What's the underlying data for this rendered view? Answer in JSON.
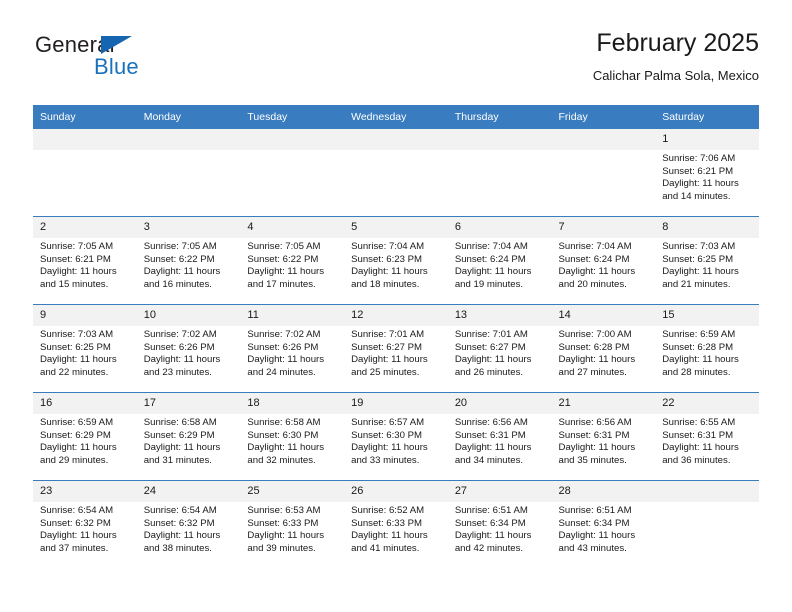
{
  "brand": {
    "line1": "General",
    "line2": "Blue",
    "triangle_color": "#1565b0",
    "blue_color": "#1972bb"
  },
  "header": {
    "title": "February 2025",
    "subtitle": "Calichar Palma Sola, Mexico"
  },
  "theme": {
    "header_bg": "#3a7cc0",
    "daynum_bg": "#f2f2f2",
    "row_border": "#3a7cc0"
  },
  "weekday_headers": [
    "Sunday",
    "Monday",
    "Tuesday",
    "Wednesday",
    "Thursday",
    "Friday",
    "Saturday"
  ],
  "weeks": [
    [
      {
        "day": "",
        "sunrise": "",
        "sunset": "",
        "daylight1": "",
        "daylight2": ""
      },
      {
        "day": "",
        "sunrise": "",
        "sunset": "",
        "daylight1": "",
        "daylight2": ""
      },
      {
        "day": "",
        "sunrise": "",
        "sunset": "",
        "daylight1": "",
        "daylight2": ""
      },
      {
        "day": "",
        "sunrise": "",
        "sunset": "",
        "daylight1": "",
        "daylight2": ""
      },
      {
        "day": "",
        "sunrise": "",
        "sunset": "",
        "daylight1": "",
        "daylight2": ""
      },
      {
        "day": "",
        "sunrise": "",
        "sunset": "",
        "daylight1": "",
        "daylight2": ""
      },
      {
        "day": "1",
        "sunrise": "Sunrise: 7:06 AM",
        "sunset": "Sunset: 6:21 PM",
        "daylight1": "Daylight: 11 hours",
        "daylight2": "and 14 minutes."
      }
    ],
    [
      {
        "day": "2",
        "sunrise": "Sunrise: 7:05 AM",
        "sunset": "Sunset: 6:21 PM",
        "daylight1": "Daylight: 11 hours",
        "daylight2": "and 15 minutes."
      },
      {
        "day": "3",
        "sunrise": "Sunrise: 7:05 AM",
        "sunset": "Sunset: 6:22 PM",
        "daylight1": "Daylight: 11 hours",
        "daylight2": "and 16 minutes."
      },
      {
        "day": "4",
        "sunrise": "Sunrise: 7:05 AM",
        "sunset": "Sunset: 6:22 PM",
        "daylight1": "Daylight: 11 hours",
        "daylight2": "and 17 minutes."
      },
      {
        "day": "5",
        "sunrise": "Sunrise: 7:04 AM",
        "sunset": "Sunset: 6:23 PM",
        "daylight1": "Daylight: 11 hours",
        "daylight2": "and 18 minutes."
      },
      {
        "day": "6",
        "sunrise": "Sunrise: 7:04 AM",
        "sunset": "Sunset: 6:24 PM",
        "daylight1": "Daylight: 11 hours",
        "daylight2": "and 19 minutes."
      },
      {
        "day": "7",
        "sunrise": "Sunrise: 7:04 AM",
        "sunset": "Sunset: 6:24 PM",
        "daylight1": "Daylight: 11 hours",
        "daylight2": "and 20 minutes."
      },
      {
        "day": "8",
        "sunrise": "Sunrise: 7:03 AM",
        "sunset": "Sunset: 6:25 PM",
        "daylight1": "Daylight: 11 hours",
        "daylight2": "and 21 minutes."
      }
    ],
    [
      {
        "day": "9",
        "sunrise": "Sunrise: 7:03 AM",
        "sunset": "Sunset: 6:25 PM",
        "daylight1": "Daylight: 11 hours",
        "daylight2": "and 22 minutes."
      },
      {
        "day": "10",
        "sunrise": "Sunrise: 7:02 AM",
        "sunset": "Sunset: 6:26 PM",
        "daylight1": "Daylight: 11 hours",
        "daylight2": "and 23 minutes."
      },
      {
        "day": "11",
        "sunrise": "Sunrise: 7:02 AM",
        "sunset": "Sunset: 6:26 PM",
        "daylight1": "Daylight: 11 hours",
        "daylight2": "and 24 minutes."
      },
      {
        "day": "12",
        "sunrise": "Sunrise: 7:01 AM",
        "sunset": "Sunset: 6:27 PM",
        "daylight1": "Daylight: 11 hours",
        "daylight2": "and 25 minutes."
      },
      {
        "day": "13",
        "sunrise": "Sunrise: 7:01 AM",
        "sunset": "Sunset: 6:27 PM",
        "daylight1": "Daylight: 11 hours",
        "daylight2": "and 26 minutes."
      },
      {
        "day": "14",
        "sunrise": "Sunrise: 7:00 AM",
        "sunset": "Sunset: 6:28 PM",
        "daylight1": "Daylight: 11 hours",
        "daylight2": "and 27 minutes."
      },
      {
        "day": "15",
        "sunrise": "Sunrise: 6:59 AM",
        "sunset": "Sunset: 6:28 PM",
        "daylight1": "Daylight: 11 hours",
        "daylight2": "and 28 minutes."
      }
    ],
    [
      {
        "day": "16",
        "sunrise": "Sunrise: 6:59 AM",
        "sunset": "Sunset: 6:29 PM",
        "daylight1": "Daylight: 11 hours",
        "daylight2": "and 29 minutes."
      },
      {
        "day": "17",
        "sunrise": "Sunrise: 6:58 AM",
        "sunset": "Sunset: 6:29 PM",
        "daylight1": "Daylight: 11 hours",
        "daylight2": "and 31 minutes."
      },
      {
        "day": "18",
        "sunrise": "Sunrise: 6:58 AM",
        "sunset": "Sunset: 6:30 PM",
        "daylight1": "Daylight: 11 hours",
        "daylight2": "and 32 minutes."
      },
      {
        "day": "19",
        "sunrise": "Sunrise: 6:57 AM",
        "sunset": "Sunset: 6:30 PM",
        "daylight1": "Daylight: 11 hours",
        "daylight2": "and 33 minutes."
      },
      {
        "day": "20",
        "sunrise": "Sunrise: 6:56 AM",
        "sunset": "Sunset: 6:31 PM",
        "daylight1": "Daylight: 11 hours",
        "daylight2": "and 34 minutes."
      },
      {
        "day": "21",
        "sunrise": "Sunrise: 6:56 AM",
        "sunset": "Sunset: 6:31 PM",
        "daylight1": "Daylight: 11 hours",
        "daylight2": "and 35 minutes."
      },
      {
        "day": "22",
        "sunrise": "Sunrise: 6:55 AM",
        "sunset": "Sunset: 6:31 PM",
        "daylight1": "Daylight: 11 hours",
        "daylight2": "and 36 minutes."
      }
    ],
    [
      {
        "day": "23",
        "sunrise": "Sunrise: 6:54 AM",
        "sunset": "Sunset: 6:32 PM",
        "daylight1": "Daylight: 11 hours",
        "daylight2": "and 37 minutes."
      },
      {
        "day": "24",
        "sunrise": "Sunrise: 6:54 AM",
        "sunset": "Sunset: 6:32 PM",
        "daylight1": "Daylight: 11 hours",
        "daylight2": "and 38 minutes."
      },
      {
        "day": "25",
        "sunrise": "Sunrise: 6:53 AM",
        "sunset": "Sunset: 6:33 PM",
        "daylight1": "Daylight: 11 hours",
        "daylight2": "and 39 minutes."
      },
      {
        "day": "26",
        "sunrise": "Sunrise: 6:52 AM",
        "sunset": "Sunset: 6:33 PM",
        "daylight1": "Daylight: 11 hours",
        "daylight2": "and 41 minutes."
      },
      {
        "day": "27",
        "sunrise": "Sunrise: 6:51 AM",
        "sunset": "Sunset: 6:34 PM",
        "daylight1": "Daylight: 11 hours",
        "daylight2": "and 42 minutes."
      },
      {
        "day": "28",
        "sunrise": "Sunrise: 6:51 AM",
        "sunset": "Sunset: 6:34 PM",
        "daylight1": "Daylight: 11 hours",
        "daylight2": "and 43 minutes."
      },
      {
        "day": "",
        "sunrise": "",
        "sunset": "",
        "daylight1": "",
        "daylight2": ""
      }
    ]
  ]
}
